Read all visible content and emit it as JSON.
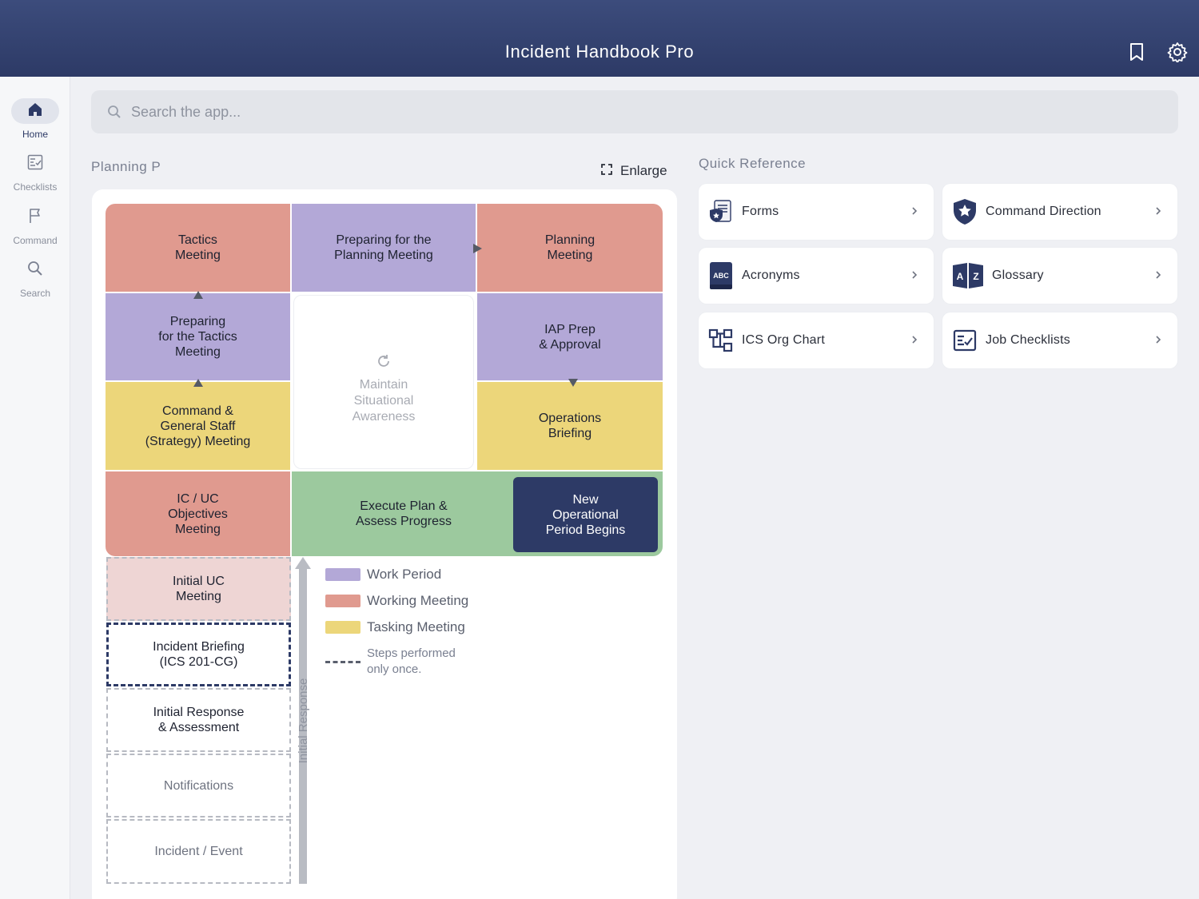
{
  "app": {
    "title": "Incident Handbook Pro"
  },
  "header": {
    "bookmark_icon": "bookmark-icon",
    "settings_icon": "gear-icon"
  },
  "sidebar": {
    "items": [
      {
        "label": "Home",
        "icon": "home-icon",
        "active": true
      },
      {
        "label": "Checklists",
        "icon": "checklist-icon",
        "active": false
      },
      {
        "label": "Command",
        "icon": "flag-icon",
        "active": false
      },
      {
        "label": "Search",
        "icon": "search-icon",
        "active": false
      }
    ]
  },
  "search": {
    "placeholder": "Search the app...",
    "value": ""
  },
  "planning": {
    "title": "Planning P",
    "enlarge_label": "Enlarge",
    "cells": {
      "tactics_meeting": "Tactics\nMeeting",
      "preparing_planning": "Preparing for the\nPlanning Meeting",
      "planning_meeting": "Planning\nMeeting",
      "preparing_tactics": "Preparing\nfor the Tactics\nMeeting",
      "maintain_awareness": "Maintain\nSituational\nAwareness",
      "iap_prep": "IAP Prep\n& Approval",
      "command_general": "Command &\nGeneral Staff\n(Strategy) Meeting",
      "operations_briefing": "Operations\nBriefing",
      "ic_uc_objectives": "IC / UC\nObjectives\nMeeting",
      "execute_plan": "Execute Plan &\nAssess Progress",
      "new_operational": "New\nOperational\nPeriod Begins",
      "initial_uc": "Initial UC\nMeeting",
      "incident_briefing": "Incident Briefing\n(ICS 201-CG)",
      "initial_response": "Initial Response\n& Assessment",
      "notifications": "Notifications",
      "incident_event": "Incident / Event"
    },
    "vertical_label": "Initial Response",
    "legend": [
      {
        "label": "Work Period",
        "color": "#b3a8d7"
      },
      {
        "label": "Working Meeting",
        "color": "#e09a8f"
      },
      {
        "label": "Tasking Meeting",
        "color": "#ecd67a"
      },
      {
        "label": "Steps performed\nonly once.",
        "style": "dashed"
      }
    ],
    "colors": {
      "work_period": "#b3a8d7",
      "working_meeting": "#e09a8f",
      "tasking_meeting": "#ecd67a",
      "execute": "#9cc99e",
      "navy": "#2d3a66"
    }
  },
  "quick_reference": {
    "title": "Quick Reference",
    "items": [
      {
        "label": "Forms",
        "icon": "forms-icon"
      },
      {
        "label": "Command Direction",
        "icon": "shield-star-icon"
      },
      {
        "label": "Acronyms",
        "icon": "abc-book-icon"
      },
      {
        "label": "Glossary",
        "icon": "az-book-icon"
      },
      {
        "label": "ICS Org Chart",
        "icon": "org-chart-icon"
      },
      {
        "label": "Job Checklists",
        "icon": "checklist-icon"
      }
    ]
  }
}
